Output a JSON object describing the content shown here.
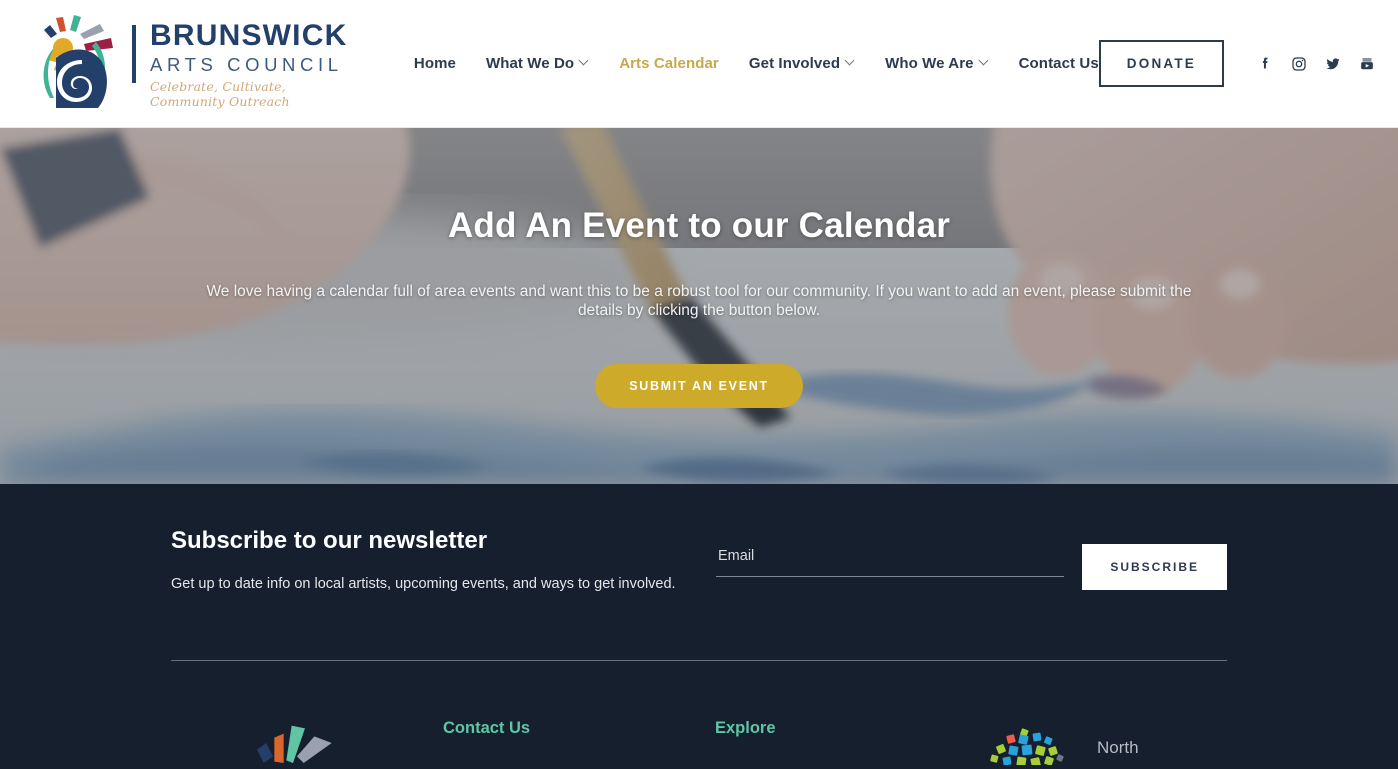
{
  "header": {
    "brand": {
      "name": "BRUNSWICK",
      "subtitle": "ARTS COUNCIL",
      "tagline": "Celebrate, Cultivate, Community Outreach",
      "logo_icon": "brunswick-arts-council-spiral-logo"
    },
    "nav": [
      {
        "label": "Home",
        "has_dropdown": false,
        "active": false
      },
      {
        "label": "What We Do",
        "has_dropdown": true,
        "active": false
      },
      {
        "label": "Arts Calendar",
        "has_dropdown": false,
        "active": true
      },
      {
        "label": "Get Involved",
        "has_dropdown": true,
        "active": false
      },
      {
        "label": "Who We Are",
        "has_dropdown": true,
        "active": false
      },
      {
        "label": "Contact Us",
        "has_dropdown": false,
        "active": false
      }
    ],
    "donate_label": "DONATE",
    "socials": [
      {
        "name": "facebook-icon"
      },
      {
        "name": "instagram-icon"
      },
      {
        "name": "twitter-icon"
      },
      {
        "name": "youtube-icon"
      }
    ],
    "accent_color": "#c9a84c",
    "text_color": "#2d3b4e"
  },
  "hero": {
    "title": "Add An Event to our Calendar",
    "subtitle": "We love having a calendar full of area events and want this to be a robust tool for our community. If you want to add an event, please submit the details by clicking the button below.",
    "button_label": "SUBMIT AN EVENT",
    "button_color": "#ceaa2a",
    "background": "photo of hands painting blue watercolor strokes on paper"
  },
  "newsletter": {
    "title": "Subscribe to our newsletter",
    "description": "Get up to date info on local artists, upcoming events, and ways to get involved.",
    "email_placeholder": "Email",
    "email_value": "",
    "subscribe_label": "SUBSCRIBE"
  },
  "footer": {
    "background_color": "#161f2e",
    "heading_color": "#5fc5a4",
    "columns": {
      "contact_heading": "Contact Us",
      "explore_heading": "Explore"
    },
    "logo_icon": "brunswick-arts-council-fan-logo",
    "partner": {
      "logo_icon": "north-carolina-arts-mosaic-icon",
      "name": "North"
    }
  }
}
